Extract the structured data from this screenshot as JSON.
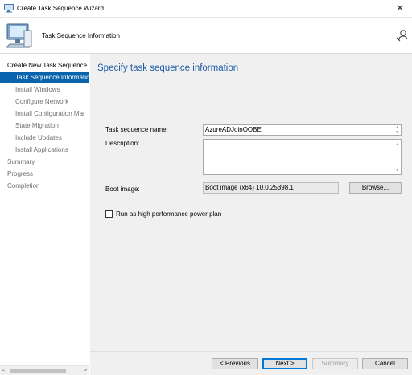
{
  "window": {
    "title": "Create Task Sequence Wizard",
    "close_glyph": "✕"
  },
  "header": {
    "title": "Task Sequence Information"
  },
  "nav": {
    "items": [
      {
        "label": "Create New Task Sequence"
      },
      {
        "label": "Task Sequence Informatio"
      },
      {
        "label": "Install Windows"
      },
      {
        "label": "Configure Network"
      },
      {
        "label": "Install Configuration Mar"
      },
      {
        "label": "State Migration"
      },
      {
        "label": "Include Updates"
      },
      {
        "label": "Install Applications"
      },
      {
        "label": "Summary"
      },
      {
        "label": "Progress"
      },
      {
        "label": "Completion"
      }
    ],
    "active_index": 1
  },
  "scroll": {
    "left_arrow": "<",
    "right_arrow": ">"
  },
  "main": {
    "heading": "Specify task sequence information",
    "name_label": "Task sequence name:",
    "name_value": "AzureADJoinOOBE",
    "description_label": "Description:",
    "description_value": "",
    "boot_label": "Boot image:",
    "boot_value": "Boot image (x64) 10.0.25398.1",
    "browse_label": "Browse...",
    "power_plan_label": "Run as high performance power plan",
    "power_plan_checked": false
  },
  "footer": {
    "previous_label": "< Previous",
    "next_label": "Next >",
    "summary_label": "Summary",
    "cancel_label": "Cancel"
  },
  "colors": {
    "accent": "#0a64ad",
    "heading": "#1e5aa8",
    "content_bg": "#f0f0f0"
  }
}
